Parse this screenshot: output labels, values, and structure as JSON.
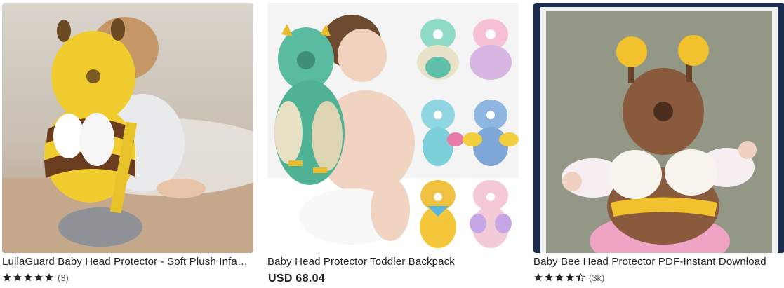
{
  "products": [
    {
      "title": "LullaGuard Baby Head Protector - Soft Plush Infant Safety Cushion",
      "rating_stars": 5,
      "review_count": "(3)",
      "image": "bee-plush-head-protector-photo"
    },
    {
      "title": "Baby Head Protector Toddler Backpack",
      "price": "USD 68.04",
      "image": "owl-head-protector-collage"
    },
    {
      "title": "Baby Bee Head Protector PDF-Instant Download",
      "rating_stars": 4.5,
      "review_count": "(3k)",
      "image": "crochet-bee-head-protector-photo"
    }
  ],
  "colors": {
    "star": "#222222",
    "text": "#222222",
    "muted": "#595959"
  }
}
